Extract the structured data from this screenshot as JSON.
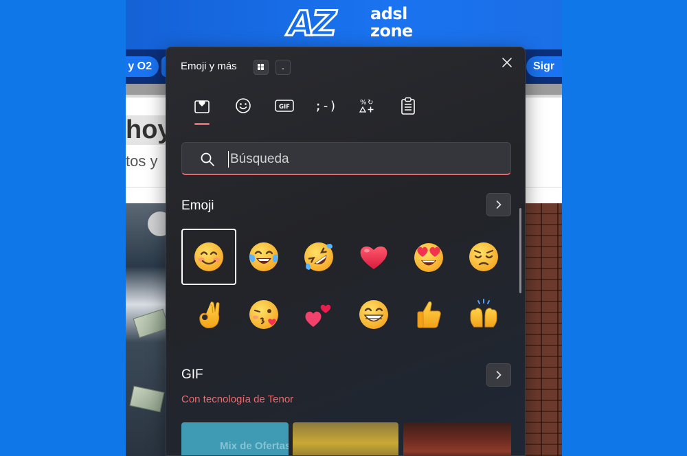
{
  "background_site": {
    "logo": {
      "mark": "AZ",
      "line1": "adsl",
      "line2": "zone"
    },
    "nav": {
      "left_pill": "y O2",
      "right_pill": "Sigr"
    },
    "headline_fragment": "hoy",
    "subline_fragment": "tos y"
  },
  "emoji_panel": {
    "title": "Emoji y más",
    "shortcut_dot": ".",
    "tabs": [
      {
        "name": "favorites",
        "icon": "heart-box-icon"
      },
      {
        "name": "emoji",
        "icon": "smiley-icon"
      },
      {
        "name": "gif",
        "icon": "gif-icon",
        "text": "GIF"
      },
      {
        "name": "kaomoji",
        "icon": "kaomoji-icon",
        "text": ";-)"
      },
      {
        "name": "symbols",
        "icon": "symbols-icon"
      },
      {
        "name": "clipboard",
        "icon": "clipboard-icon"
      }
    ],
    "active_tab": "favorites",
    "search": {
      "placeholder": "Búsqueda",
      "value": ""
    },
    "sections": {
      "emoji": {
        "label": "Emoji"
      },
      "gif": {
        "label": "GIF",
        "note": "Con tecnología de Tenor"
      }
    },
    "emoji_items": [
      "smiling-face-with-smiling-eyes",
      "face-with-tears-of-joy",
      "rolling-on-the-floor-laughing",
      "red-heart",
      "smiling-face-with-heart-eyes",
      "pensive-face",
      "ok-hand",
      "face-blowing-a-kiss",
      "two-hearts",
      "beaming-face-with-smiling-eyes",
      "thumbs-up",
      "raising-hands"
    ],
    "selected_emoji": "smiling-face-with-smiling-eyes",
    "gif_tile_text": "Mix de Ofertas",
    "colors": {
      "accent": "#e8656b",
      "panel_bg": "#232428",
      "tenor_text": "#ef6a6f"
    }
  }
}
